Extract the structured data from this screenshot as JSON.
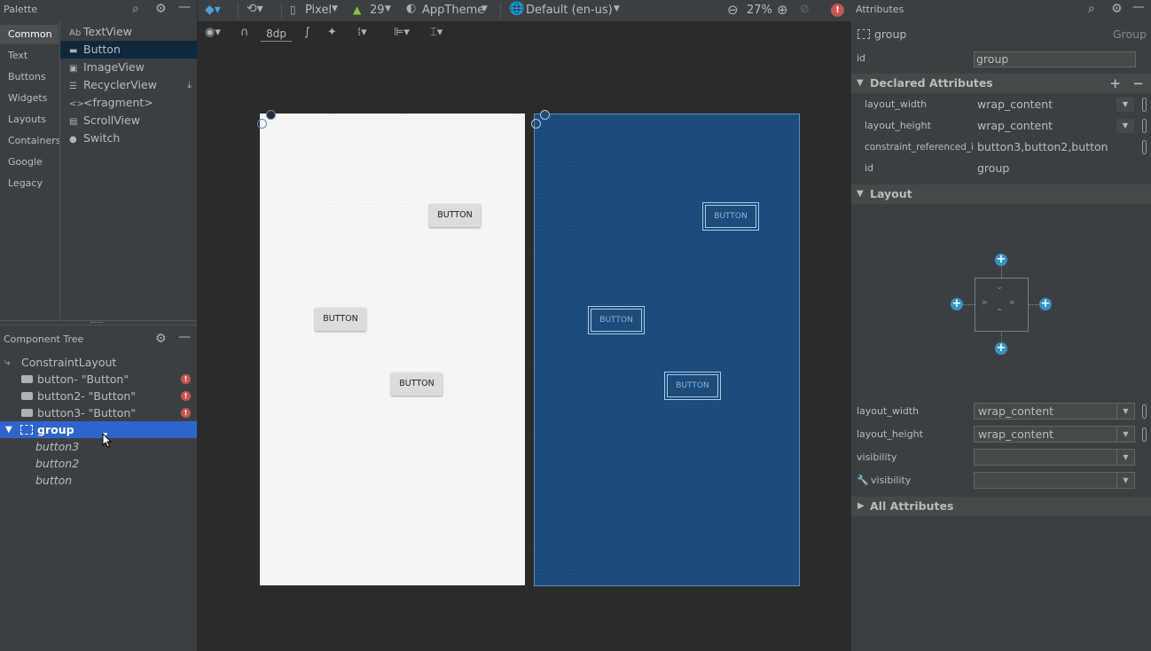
{
  "palette": {
    "title": "Palette",
    "categories": [
      "Common",
      "Text",
      "Buttons",
      "Widgets",
      "Layouts",
      "Containers",
      "Google",
      "Legacy"
    ],
    "items": [
      {
        "glyph": "Ab",
        "label": "TextView"
      },
      {
        "glyph": "▬",
        "label": "Button"
      },
      {
        "glyph": "▣",
        "label": "ImageView"
      },
      {
        "glyph": "☰",
        "label": "RecyclerView"
      },
      {
        "glyph": "<>",
        "label": "<fragment>"
      },
      {
        "glyph": "▤",
        "label": "ScrollView"
      },
      {
        "glyph": "●",
        "label": "Switch"
      }
    ]
  },
  "component_tree": {
    "title": "Component Tree",
    "root": "ConstraintLayout",
    "children": [
      "button- \"Button\"",
      "button2- \"Button\"",
      "button3- \"Button\""
    ],
    "group": "group",
    "group_members": [
      "button3",
      "button2",
      "button"
    ]
  },
  "toolbar": {
    "device": "Pixel",
    "api": "29",
    "theme": "AppTheme",
    "locale": "Default (en-us)",
    "zoom": "27%",
    "margin": "8dp"
  },
  "canvas": {
    "button_label": "BUTTON"
  },
  "attributes": {
    "title": "Attributes",
    "component_name": "group",
    "component_type": "Group",
    "id_label": "id",
    "id_value": "group",
    "declared_section": "Declared Attributes",
    "declared": [
      {
        "key": "layout_width",
        "value": "wrap_content"
      },
      {
        "key": "layout_height",
        "value": "wrap_content"
      },
      {
        "key": "constraint_referenced_ids",
        "value": "button3,button2,button"
      },
      {
        "key": "id",
        "value": "group"
      }
    ],
    "layout_section": "Layout",
    "layout": [
      {
        "key": "layout_width",
        "value": "wrap_content"
      },
      {
        "key": "layout_height",
        "value": "wrap_content"
      },
      {
        "key": "visibility",
        "value": ""
      },
      {
        "key": "visibility",
        "value": ""
      }
    ],
    "all_section": "All Attributes"
  }
}
